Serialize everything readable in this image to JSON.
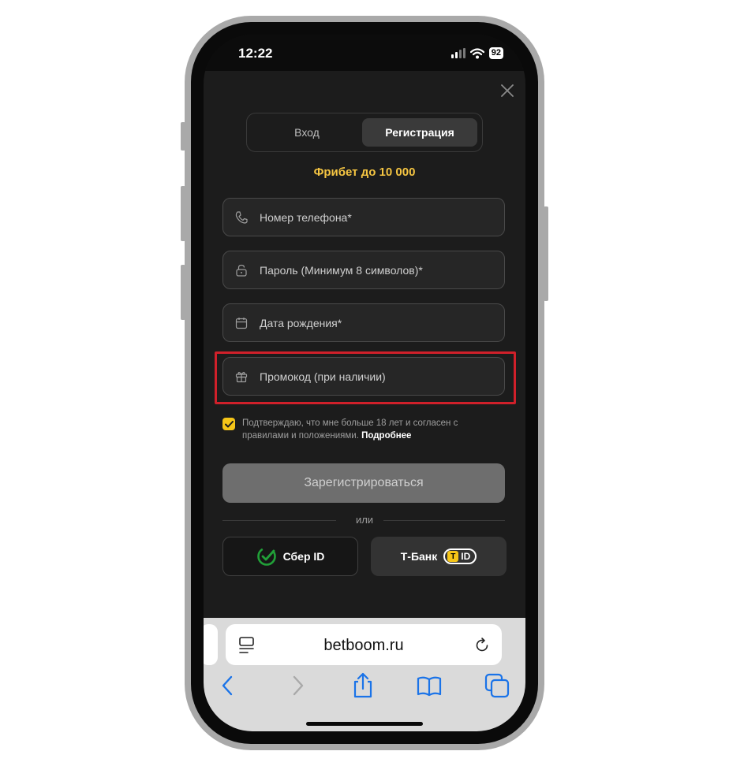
{
  "status": {
    "time": "12:22",
    "battery": "92"
  },
  "auth": {
    "tabs": {
      "login": "Вход",
      "register": "Регистрация"
    },
    "promo_banner": "Фрибет до 10 000",
    "fields": {
      "phone": "Номер телефона*",
      "password": "Пароль (Минимум 8 символов)*",
      "birthdate": "Дата рождения*",
      "promocode": "Промокод (при наличии)"
    },
    "agree_text": "Подтверждаю, что мне больше 18 лет и согласен с правилами и положениями.",
    "agree_more": "Подробнее",
    "agree_checked": true,
    "register_button": "Зарегистрироваться",
    "or_divider": "или",
    "sber_label": "Сбер ID",
    "tbank_label": "Т-Банк",
    "tbank_id": "ID"
  },
  "browser": {
    "url": "betboom.ru"
  },
  "colors": {
    "accent_yellow": "#f5c518",
    "highlight_red": "#d0202a",
    "sber_green": "#21a038",
    "ios_blue": "#1a73e8"
  },
  "icons": {
    "phone": "phone-icon",
    "password": "lock-icon",
    "birthdate": "calendar-icon",
    "promocode": "gift-icon",
    "close": "close-icon",
    "back": "back-chevron-icon",
    "forward": "forward-chevron-icon",
    "share": "share-icon",
    "bookmarks": "bookmarks-icon",
    "tabs": "tabs-icon",
    "reload": "reload-icon",
    "reader": "reader-mode-icon"
  }
}
